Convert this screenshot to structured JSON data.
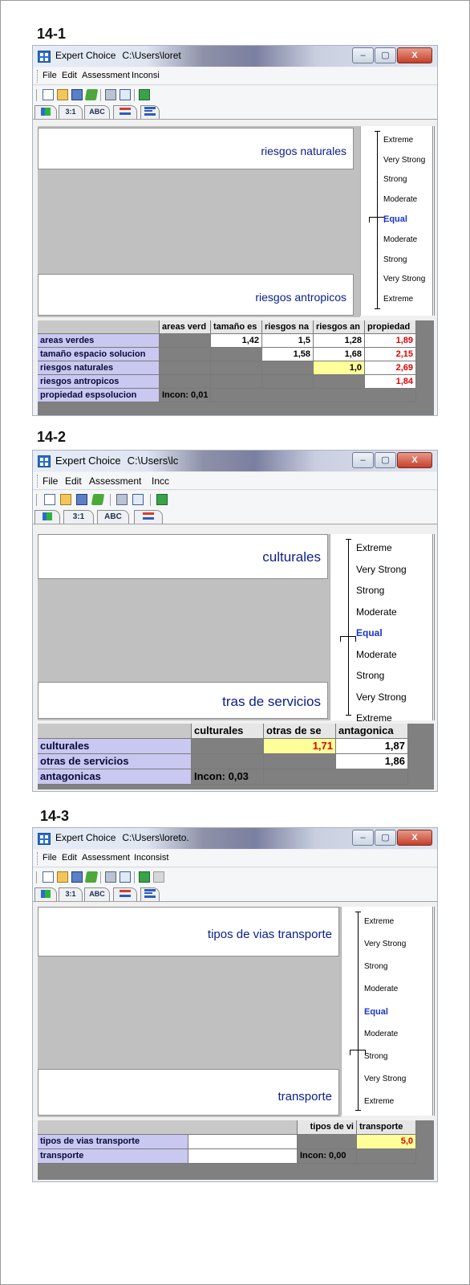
{
  "labels": [
    "14-1",
    "14-2",
    "14-3"
  ],
  "window": {
    "app_name": "Expert Choice",
    "menu": [
      "File",
      "Edit",
      "Assessment"
    ],
    "tabs": [
      "3:1",
      "ABC"
    ],
    "win_buttons": [
      "–",
      "▢",
      "X"
    ]
  },
  "panels": [
    {
      "title_path": "C:\\Users\\loret",
      "menu_cut": "Inconsi",
      "top_name": "riesgos naturales",
      "bottom_name": "riesgos antropicos",
      "scale": [
        "Extreme",
        "Very Strong",
        "Strong",
        "Moderate",
        "Equal",
        "Moderate",
        "Strong",
        "Very Strong",
        "Extreme"
      ],
      "columns": [
        "areas verd",
        "tamaño es",
        "riesgos na",
        "riesgos an",
        "propiedad"
      ],
      "rows": [
        {
          "name": "areas verdes",
          "cells": [
            "",
            "1,42",
            "1,5",
            "1,28",
            "1,89"
          ]
        },
        {
          "name": "tamaño espacio solucion",
          "cells": [
            "",
            "",
            "1,58",
            "1,68",
            "2,15"
          ]
        },
        {
          "name": "riesgos naturales",
          "cells": [
            "",
            "",
            "",
            "1,0",
            "2,69"
          ]
        },
        {
          "name": "riesgos antropicos",
          "cells": [
            "",
            "",
            "",
            "",
            "1,84"
          ]
        },
        {
          "name": "propiedad espsolucion",
          "cells": [
            "Incon: 0,01",
            "",
            "",
            "",
            ""
          ]
        }
      ]
    },
    {
      "title_path": "C:\\Users\\lc",
      "menu_cut": "Incc",
      "top_name": "culturales",
      "bottom_name": "tras de servicios",
      "scale": [
        "Extreme",
        "Very Strong",
        "Strong",
        "Moderate",
        "Equal",
        "Moderate",
        "Strong",
        "Very Strong",
        "Extreme"
      ],
      "columns": [
        "culturales",
        "otras de se",
        "antagonica"
      ],
      "rows": [
        {
          "name": "culturales",
          "cells": [
            "",
            "1,71",
            "1,87"
          ]
        },
        {
          "name": "otras de servicios",
          "cells": [
            "",
            "",
            "1,86"
          ]
        },
        {
          "name": "antagonicas",
          "cells": [
            "Incon: 0,03",
            "",
            ""
          ]
        }
      ]
    },
    {
      "title_path": "C:\\Users\\loreto.",
      "menu_cut": "Inconsist",
      "top_name": "tipos de vias transporte",
      "bottom_name": "transporte",
      "scale": [
        "Extreme",
        "Very Strong",
        "Strong",
        "Moderate",
        "Equal",
        "Moderate",
        "Strong",
        "Very Strong",
        "Extreme"
      ],
      "columns": [
        "tipos de vi",
        "transporte"
      ],
      "rows": [
        {
          "name": "tipos de vias transporte",
          "cells": [
            "",
            "5,0"
          ]
        },
        {
          "name": "transporte",
          "cells": [
            "Incon: 0,00",
            ""
          ]
        }
      ]
    }
  ]
}
